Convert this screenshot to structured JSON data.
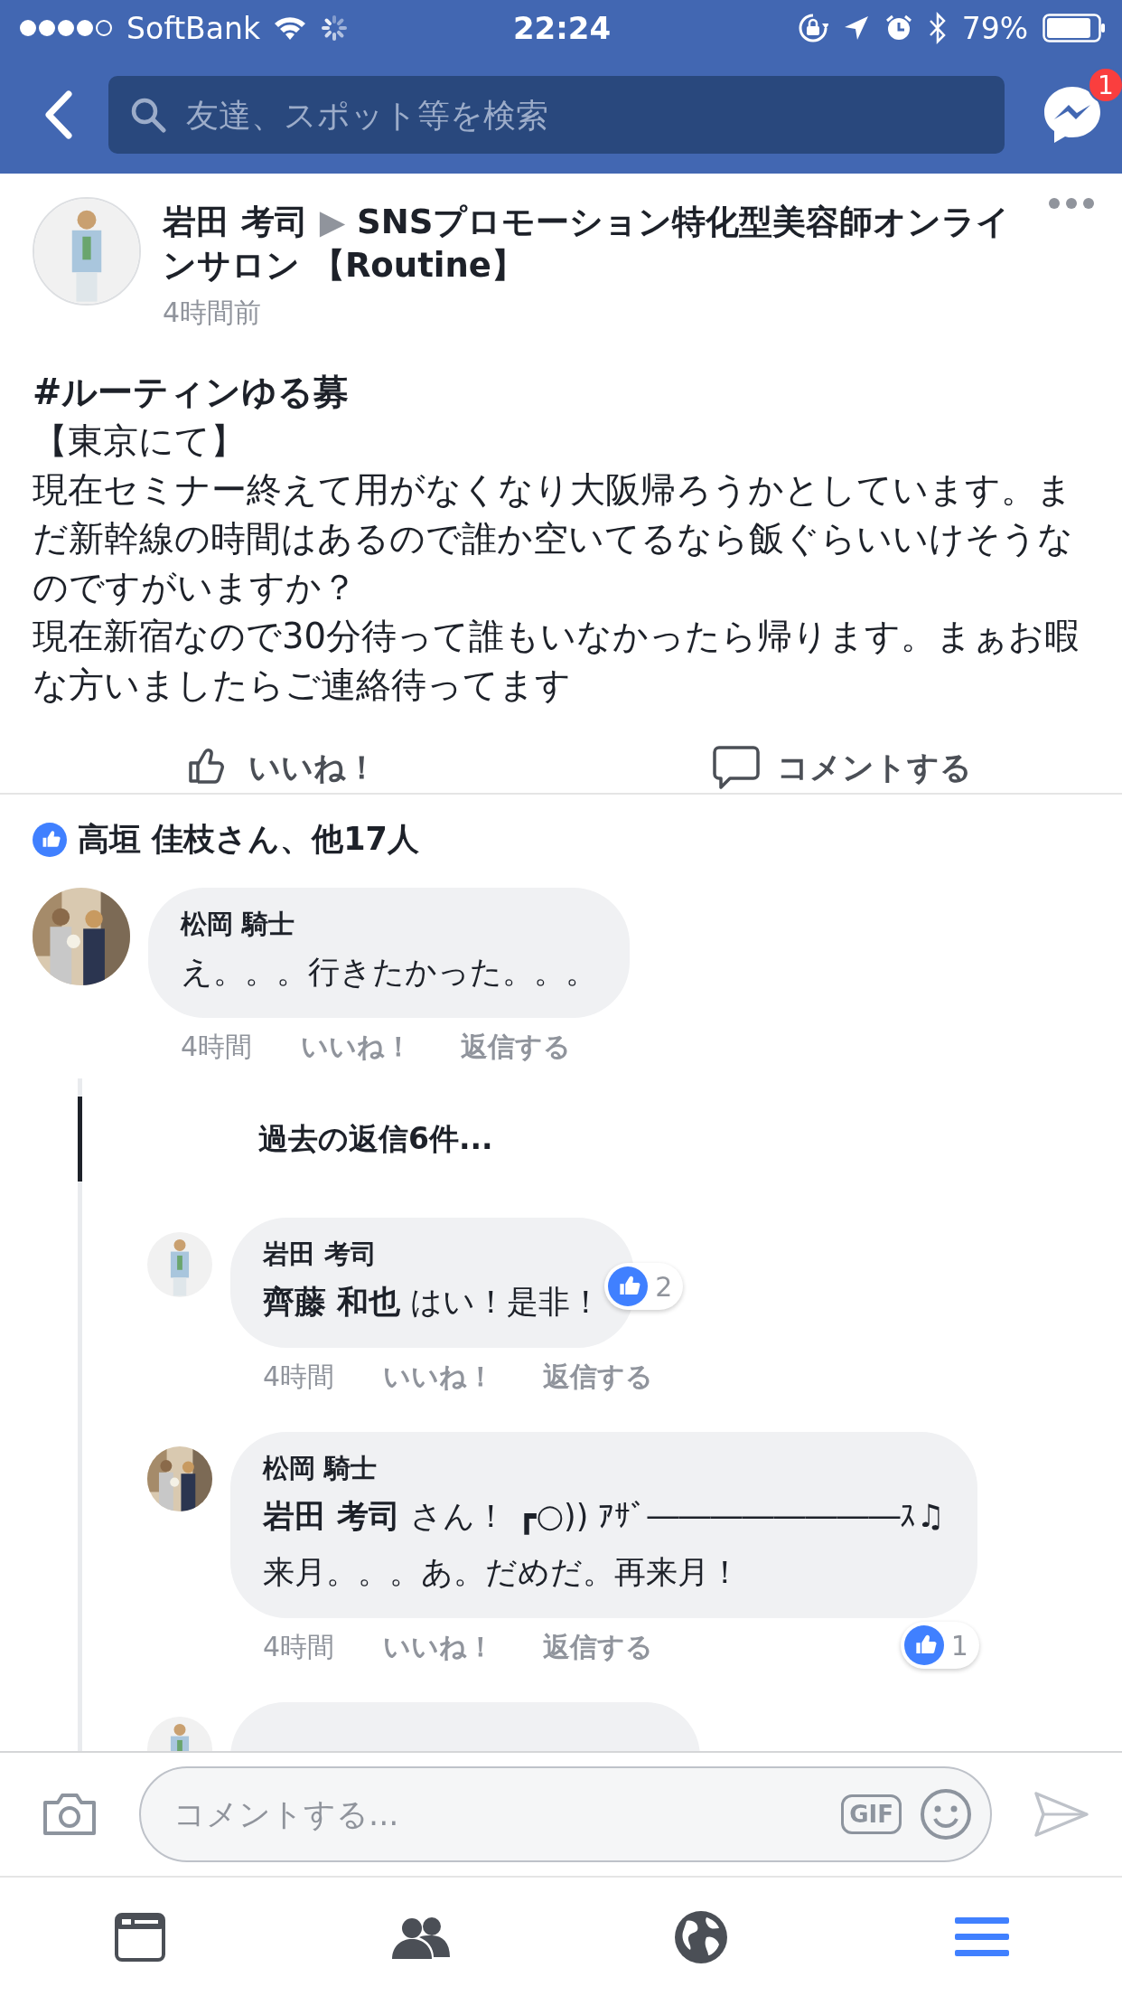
{
  "status_bar": {
    "carrier": "SoftBank",
    "time": "22:24",
    "battery": "79%"
  },
  "nav": {
    "search": {
      "placeholder": "友達、スポット等を検索"
    },
    "messenger_badge": "1"
  },
  "post": {
    "author": "岩田 考司",
    "separator": "▶",
    "group": "SNSプロモーション特化型美容師オンラインサロン 【Routine】",
    "time": "4時間前",
    "hashtag": "#ルーティンゆる募",
    "paragraphs": [
      "【東京にて】",
      "現在セミナー終えて用がなくなり大阪帰ろうかとしています。まだ新幹線の時間はあるので誰か空いてるなら飯ぐらいいけそうなのですがいますか？",
      "現在新宿なので30分待って誰もいなかったら帰ります。まぁお暇な方いましたらご連絡待ってます"
    ],
    "actions": [
      {
        "kind": "like",
        "label": "いいね！"
      },
      {
        "kind": "comment",
        "label": "コメントする"
      }
    ],
    "likes_summary": "高垣 佳枝さん、他17人"
  },
  "comments": [
    {
      "author": "松岡 騎士",
      "lines": [
        "え。。。行きたかった。。。"
      ],
      "time": "4時間",
      "actions": [
        "いいね！",
        "返信する"
      ],
      "more_replies": "過去の返信6件...",
      "replies": [
        {
          "author": "岩田 考司",
          "lines": [
            "**齊藤 和也** はい！是非！"
          ],
          "reactions": "2",
          "time": "4時間",
          "actions": [
            "いいね！",
            "返信する"
          ]
        },
        {
          "author": "松岡 騎士",
          "lines": [
            "**岩田 考司** さん！ ┏○)) ｱｻﾞ――――――――ｽ♫",
            "来月。。。あ。だめだ。再来月！"
          ],
          "reactions": "1",
          "time": "4時間",
          "actions": [
            "いいね！",
            "返信する"
          ]
        }
      ]
    }
  ],
  "composer": {
    "placeholder": "コメントする...",
    "gif": "GIF"
  },
  "tab_bar": [
    {
      "kind": "news",
      "selected": false
    },
    {
      "kind": "friends",
      "selected": false
    },
    {
      "kind": "globe",
      "selected": false
    },
    {
      "kind": "menu",
      "selected": true
    }
  ]
}
